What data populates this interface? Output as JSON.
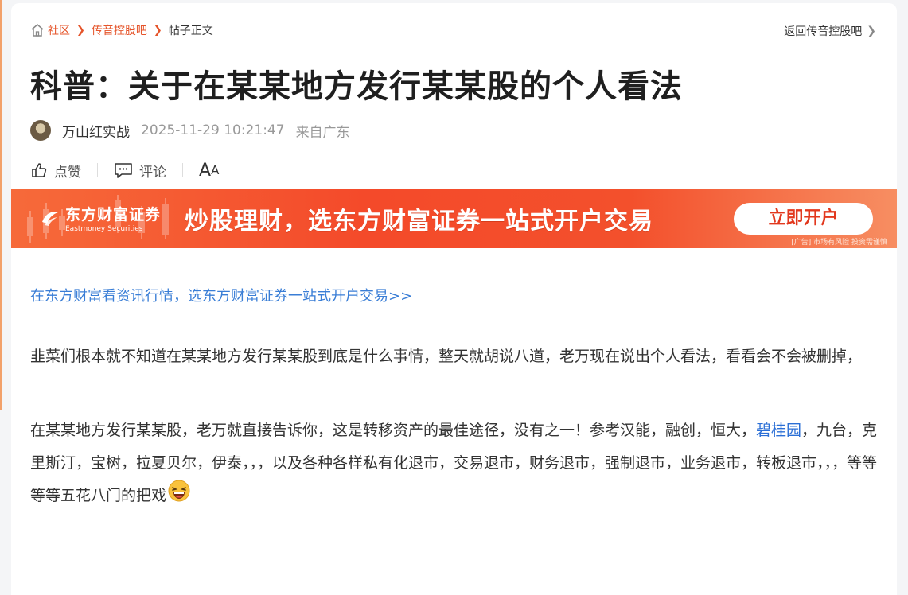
{
  "breadcrumb": {
    "items": [
      "社区",
      "传音控股吧"
    ],
    "current": "帖子正文",
    "back_label": "返回传音控股吧"
  },
  "post": {
    "title": "科普：关于在某某地方发行某某股的个人看法",
    "author": "万山红实战",
    "time": "2025-11-29 10:21:47",
    "location": "来自广东"
  },
  "actions": {
    "like_label": "点赞",
    "comment_label": "评论",
    "font_label_big": "A",
    "font_label_small": "A"
  },
  "banner": {
    "brand_cn": "东方财富证券",
    "brand_en": "Eastmoney Securities",
    "slogan": "炒股理财，选东方财富证券一站式开户交易",
    "button_label": "立即开户",
    "ad_note": "[广告] 市场有风险 投资需谨慎",
    "colors": {
      "start": "#f66a3a",
      "end": "#f78e62",
      "button_text": "#e2381e"
    }
  },
  "content": {
    "promo_link": "在东方财富看资讯行情，选东方财富证券一站式开户交易>>",
    "para1": "韭菜们根本就不知道在某某地方发行某某股到底是什么事情，整天就胡说八道，老万现在说出个人看法，看看会不会被删掉，",
    "para2_before": "在某某地方发行某某股，老万就直接告诉你，这是转移资产的最佳途径，没有之一！参考汉能，融创，恒大，",
    "para2_link": "碧桂园",
    "para2_after": "，九台，克里斯汀，宝树，拉夏贝尔，伊泰，，，以及各种各样私有化退市，交易退市，财务退市，强制退市，业务退市，转板退市，，，等等等等五花八门的把戏",
    "emoji_icon": "laughing-emoji"
  },
  "colors": {
    "accent": "#e5542a",
    "link": "#3a7ed6"
  }
}
